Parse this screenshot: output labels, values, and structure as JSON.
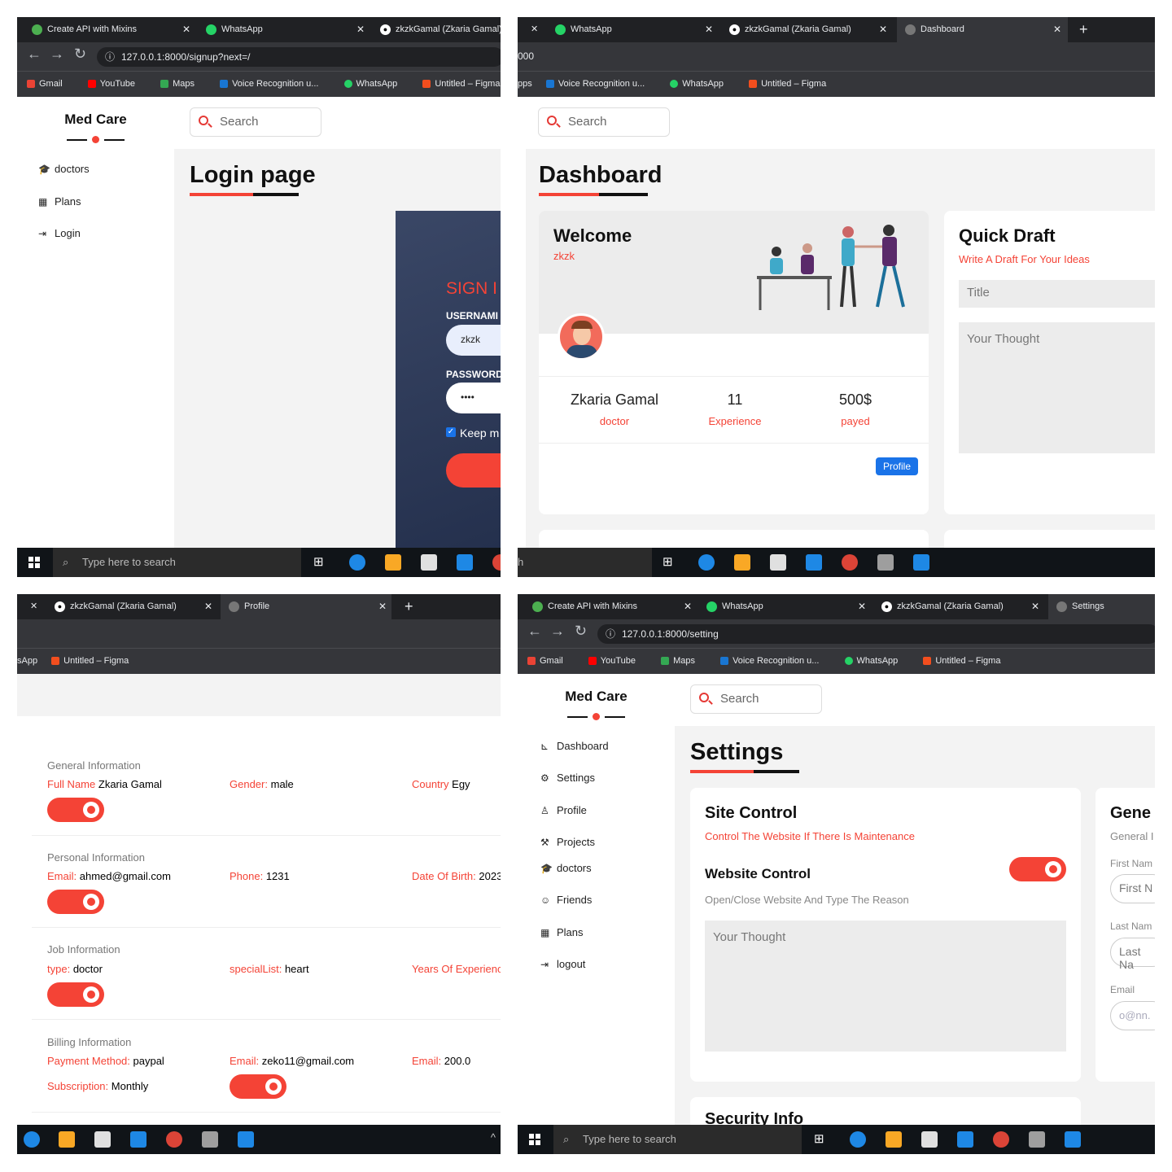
{
  "q1": {
    "tabs": [
      "Create API with Mixins",
      "WhatsApp",
      "zkzkGamal (Zkaria Gamal)"
    ],
    "url": "127.0.0.1:8000/signup?next=/",
    "bookmarks": [
      "Gmail",
      "YouTube",
      "Maps",
      "Voice Recognition u...",
      "WhatsApp",
      "Untitled – Figma"
    ],
    "brand": "Med Care",
    "side": [
      "doctors",
      "Plans",
      "Login"
    ],
    "search": "Search",
    "title": "Login page",
    "signin": "SIGN I",
    "username_label": "USERNAMI",
    "username_value": "zkzk",
    "password_label": "PASSWORD",
    "password_value": "••••",
    "keep": "Keep m",
    "task_search": "Type here to search"
  },
  "q2": {
    "tabs": [
      "WhatsApp",
      "zkzkGamal (Zkaria Gamal)",
      "Dashboard"
    ],
    "url": "000",
    "bookmarks": [
      "pps",
      "Voice Recognition u...",
      "WhatsApp",
      "Untitled – Figma"
    ],
    "search": "Search",
    "title": "Dashboard",
    "welcome": "Welcome",
    "welcome_user": "zkzk",
    "name": "Zkaria Gamal",
    "name_sub": "doctor",
    "exp_val": "11",
    "exp_sub": "Experience",
    "paid_val": "500$",
    "paid_sub": "payed",
    "profile_btn": "Profile",
    "qd_title": "Quick Draft",
    "qd_sub": "Write A Draft For Your Ideas",
    "qd_title_ph": "Title",
    "qd_thought_ph": "Your Thought",
    "task_left": "h"
  },
  "q3": {
    "tabs": [
      "zkzkGamal (Zkaria Gamal)",
      "Profile"
    ],
    "bookmarks": [
      "sApp",
      "Untitled – Figma"
    ],
    "sections": [
      {
        "title": "General Information",
        "a_k": "Full Name",
        "a_v": "Zkaria Gamal",
        "b_k": "Gender:",
        "b_v": "male",
        "c_k": "Country",
        "c_v": "Egy"
      },
      {
        "title": "Personal Information",
        "a_k": "Email:",
        "a_v": "ahmed@gmail.com",
        "b_k": "Phone:",
        "b_v": "1231",
        "c_k": "Date Of Birth:",
        "c_v": "2023"
      },
      {
        "title": "Job Information",
        "a_k": "type:",
        "a_v": "doctor",
        "b_k": "specialList:",
        "b_v": "heart",
        "c_k": "Years Of Experienc",
        "c_v": ""
      },
      {
        "title": "Billing Information",
        "a_k": "Payment Method:",
        "a_v": "paypal",
        "b_k": "Email:",
        "b_v": "zeko11@gmail.com",
        "c_k": "Email:",
        "c_v": "200.0",
        "d_k": "Subscription:",
        "d_v": "Monthly"
      }
    ]
  },
  "q4": {
    "tabs": [
      "Create API with Mixins",
      "WhatsApp",
      "zkzkGamal (Zkaria Gamal)",
      "Settings"
    ],
    "url": "127.0.0.1:8000/setting",
    "bookmarks": [
      "Gmail",
      "YouTube",
      "Maps",
      "Voice Recognition u...",
      "WhatsApp",
      "Untitled – Figma"
    ],
    "brand": "Med Care",
    "side": [
      "Dashboard",
      "Settings",
      "Profile",
      "Projects",
      "doctors",
      "Friends",
      "Plans",
      "logout"
    ],
    "search": "Search",
    "title": "Settings",
    "sc_title": "Site Control",
    "sc_sub": "Control The Website If There Is Maintenance",
    "wc_title": "Website Control",
    "wc_sub": "Open/Close Website And Type The Reason",
    "thought_ph": "Your Thought",
    "security": "Security Info",
    "gen_title": "Gene",
    "gen_sub": "General I",
    "first_label": "First Nam",
    "first_ph": "First N",
    "last_label": "Last Nam",
    "last_ph": "Last Na",
    "email_label": "Email",
    "email_ph": "o@nn.",
    "task_search": "Type here to search"
  },
  "colors": {
    "accent": "#f44336",
    "dark_panel": "#2f3b57",
    "blue": "#1a73e8"
  }
}
